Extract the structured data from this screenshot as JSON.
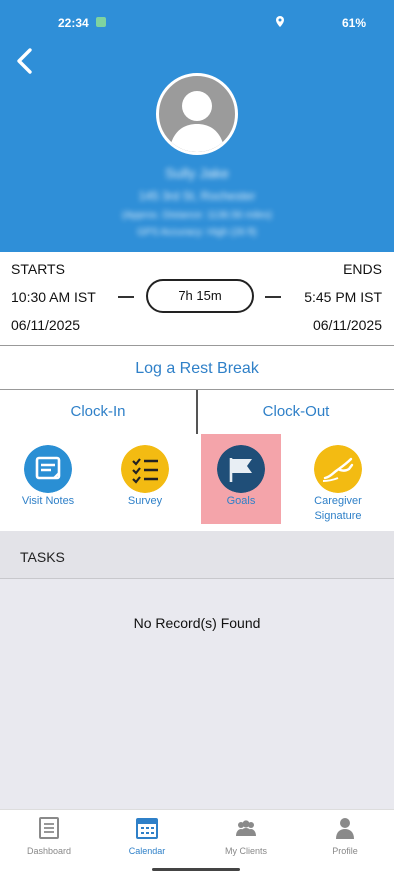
{
  "status_bar": {
    "time": "22:34",
    "right": "·               61%"
  },
  "client": {
    "name": "Sully Jake",
    "address": "145 3rd St, Rochester",
    "distance": "(Approx. Distance: 1136.56 miles)",
    "accuracy": "GPS Accuracy: High (26 ft)"
  },
  "shift": {
    "starts_label": "STARTS",
    "ends_label": "ENDS",
    "start_time": "10:30 AM IST",
    "end_time": "5:45 PM IST",
    "duration": "7h 15m",
    "start_date": "06/11/2025",
    "end_date": "06/11/2025"
  },
  "rest_break_label": "Log a Rest Break",
  "clock": {
    "in_label": "Clock-In",
    "out_label": "Clock-Out"
  },
  "actions": [
    {
      "label": "Visit Notes",
      "icon": "notes-icon",
      "color": "#2a8fd4"
    },
    {
      "label": "Survey",
      "icon": "checklist-icon",
      "color": "#f3bb12"
    },
    {
      "label": "Goals",
      "icon": "flag-icon",
      "color": "#1f4e78",
      "highlight": "#f4a4aa"
    },
    {
      "label": "Caregiver Signature",
      "icon": "signature-hand-icon",
      "color": "#f3bb12"
    }
  ],
  "tasks": {
    "title": "TASKS",
    "empty_message": "No Record(s) Found"
  },
  "bottom_nav": [
    {
      "label": "Dashboard",
      "icon": "dashboard-icon"
    },
    {
      "label": "Calendar",
      "icon": "calendar-icon",
      "active": true
    },
    {
      "label": "My Clients",
      "icon": "clients-icon"
    },
    {
      "label": "Profile",
      "icon": "profile-icon"
    }
  ],
  "colors": {
    "header": "#2f8fd8",
    "link": "#2f80c8",
    "tasks_bg": "#e9e9ef"
  }
}
